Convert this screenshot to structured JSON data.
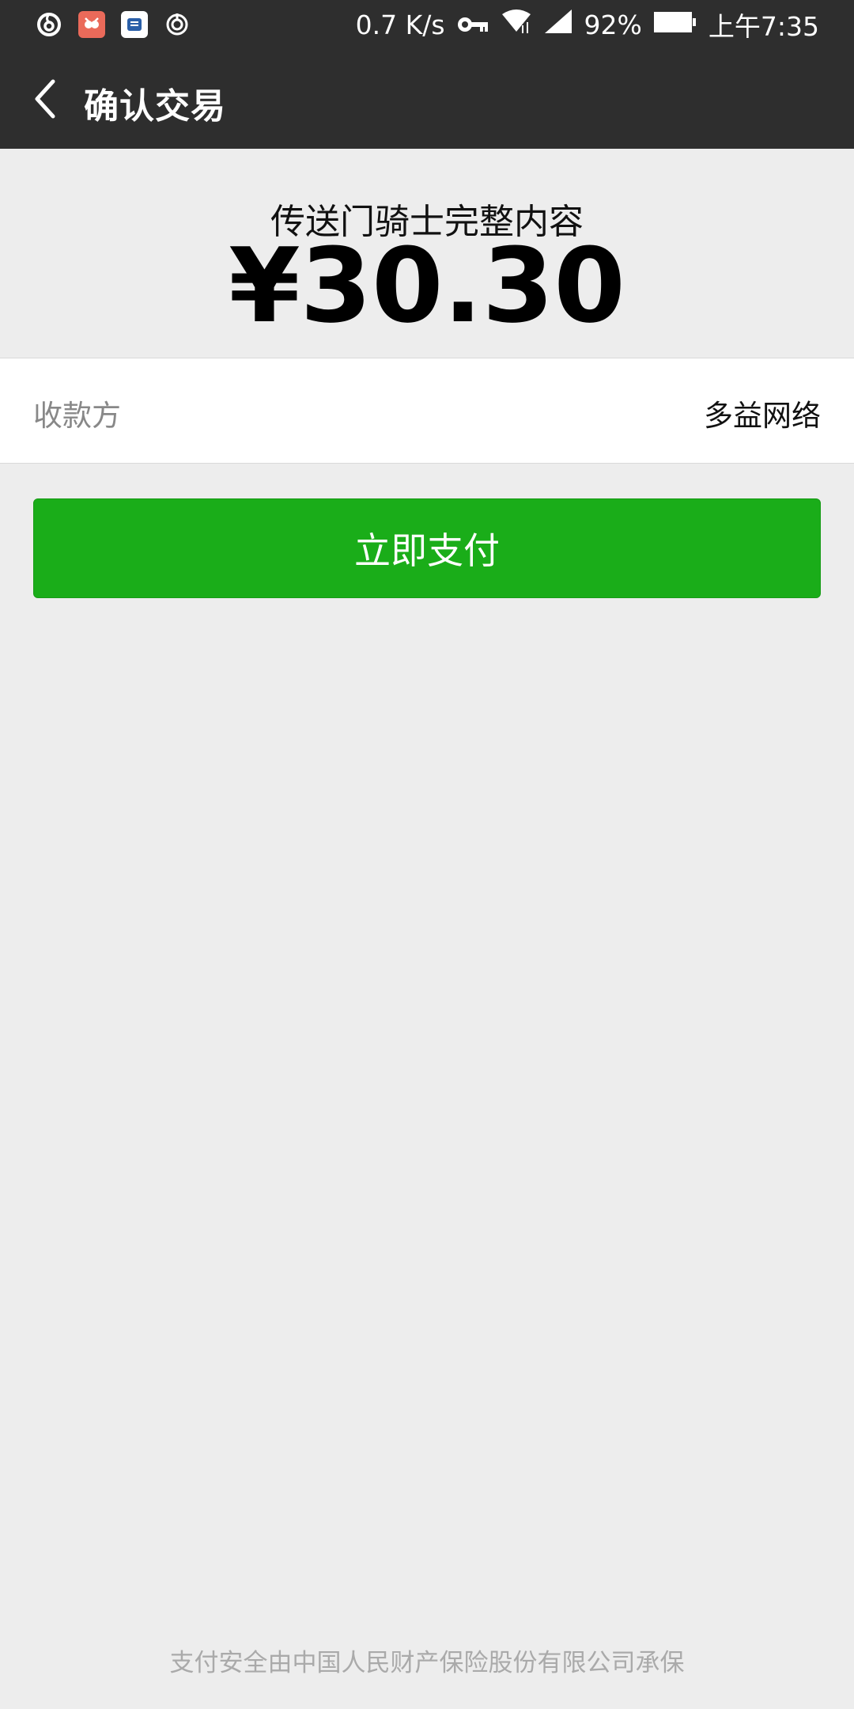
{
  "status_bar": {
    "net_speed": "0.7 K/s",
    "battery": "92%",
    "time": "上午7:35",
    "icons": [
      "netease-music-icon",
      "cartoon-app-icon",
      "news-app-icon",
      "location-icon",
      "vpn-key-icon",
      "wifi-icon",
      "signal-icon",
      "battery-icon"
    ]
  },
  "nav": {
    "title": "确认交易"
  },
  "summary": {
    "product_name": "传送门骑士完整内容",
    "amount": "¥30.30"
  },
  "payee": {
    "label": "收款方",
    "value": "多益网络"
  },
  "pay_button": {
    "label": "立即支付"
  },
  "footer": {
    "note": "支付安全由中国人民财产保险股份有限公司承保"
  },
  "colors": {
    "bar_bg": "#2e2e2e",
    "page_bg": "#ededed",
    "primary_green": "#1aad19"
  }
}
